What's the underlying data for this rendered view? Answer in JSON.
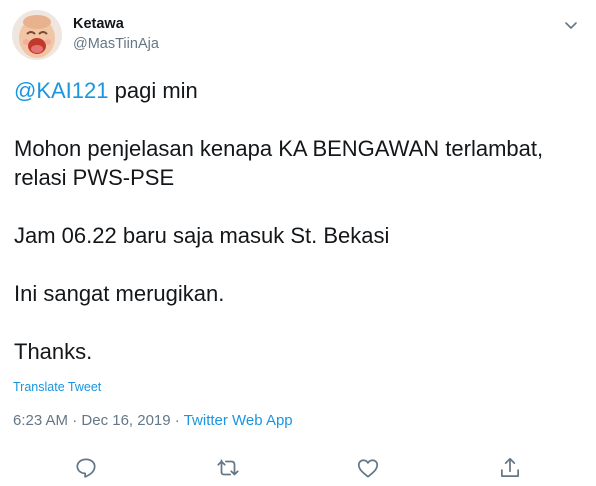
{
  "user": {
    "name": "Ketawa",
    "handle": "@MasTiinAja"
  },
  "tweet": {
    "mention": "@KAI121",
    "line1_rest": " pagi min",
    "line2": "Mohon penjelasan kenapa KA BENGAWAN terlambat,",
    "line3": "relasi PWS-PSE",
    "line4": "Jam 06.22 baru saja masuk St. Bekasi",
    "line5": "Ini sangat merugikan.",
    "line6": "Thanks."
  },
  "translate_label": "Translate Tweet",
  "meta": {
    "time": "6:23 AM",
    "sep1": " · ",
    "date": "Dec 16, 2019",
    "sep2": " · ",
    "source": "Twitter Web App"
  },
  "icons": {
    "reply": "reply-icon",
    "retweet": "retweet-icon",
    "like": "like-icon",
    "share": "share-icon",
    "caret": "chevron-down-icon"
  },
  "colors": {
    "link": "#1b95e0",
    "secondary": "#657786",
    "text": "#14171a"
  }
}
